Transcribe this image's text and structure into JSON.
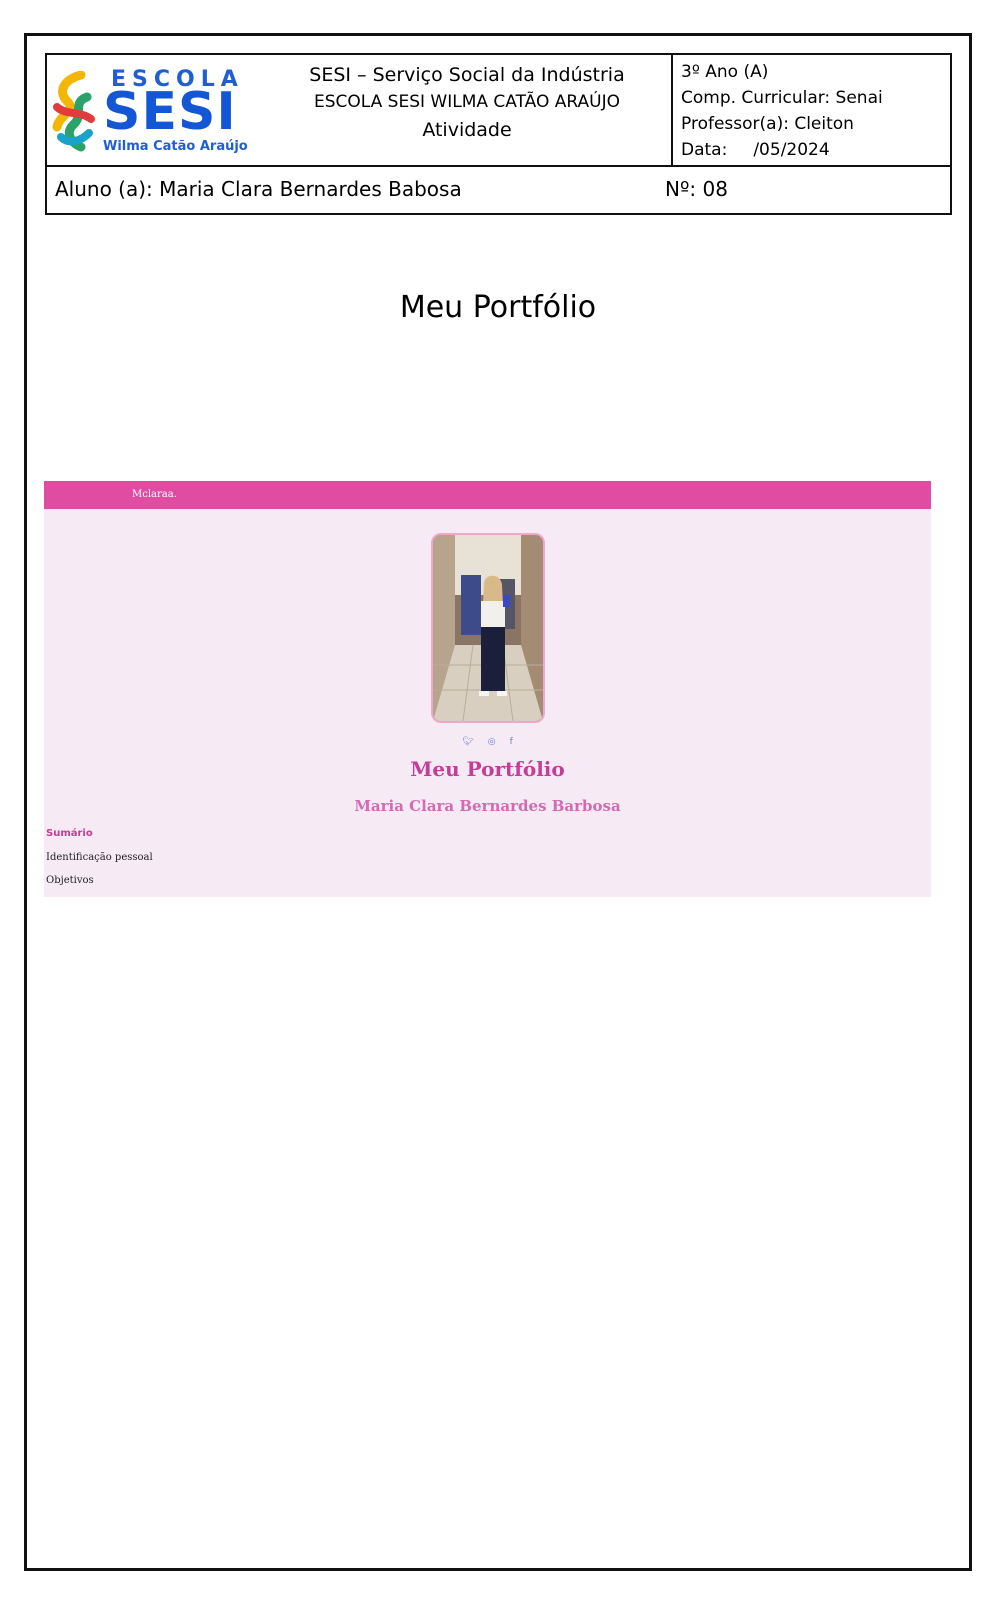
{
  "logo": {
    "line1": "ESCOLA",
    "line2": "SESI",
    "line3": "Wilma Catão Araújo"
  },
  "school": {
    "line1": "SESI – Serviço Social da Indústria",
    "line2": "ESCOLA SESI WILMA CATÃO ARAÚJO",
    "line3": "Atividade"
  },
  "class_info": {
    "year": "3º Ano (A)",
    "component": "Comp. Curricular: Senai",
    "teacher": "Professor(a): Cleiton",
    "date_label": "Data:",
    "date_value": "/05/2024"
  },
  "student": {
    "name": "Aluno (a): Maria Clara Bernardes Babosa",
    "number": "Nº: 08"
  },
  "document_title": "Meu Portfólio",
  "portfolio": {
    "brand": "Mclaraa.",
    "social_icons": [
      "twitter-icon",
      "instagram-icon",
      "facebook-icon"
    ],
    "heading": "Meu Portfólio",
    "name": "Maria Clara Bernardes Barbosa",
    "summary_title": "Sumário",
    "summary_items": [
      "Identificação pessoal",
      "Objetivos"
    ],
    "colors": {
      "nav": "#e14ca3",
      "background": "#f6eaf4",
      "heading": "#c43d98"
    }
  }
}
